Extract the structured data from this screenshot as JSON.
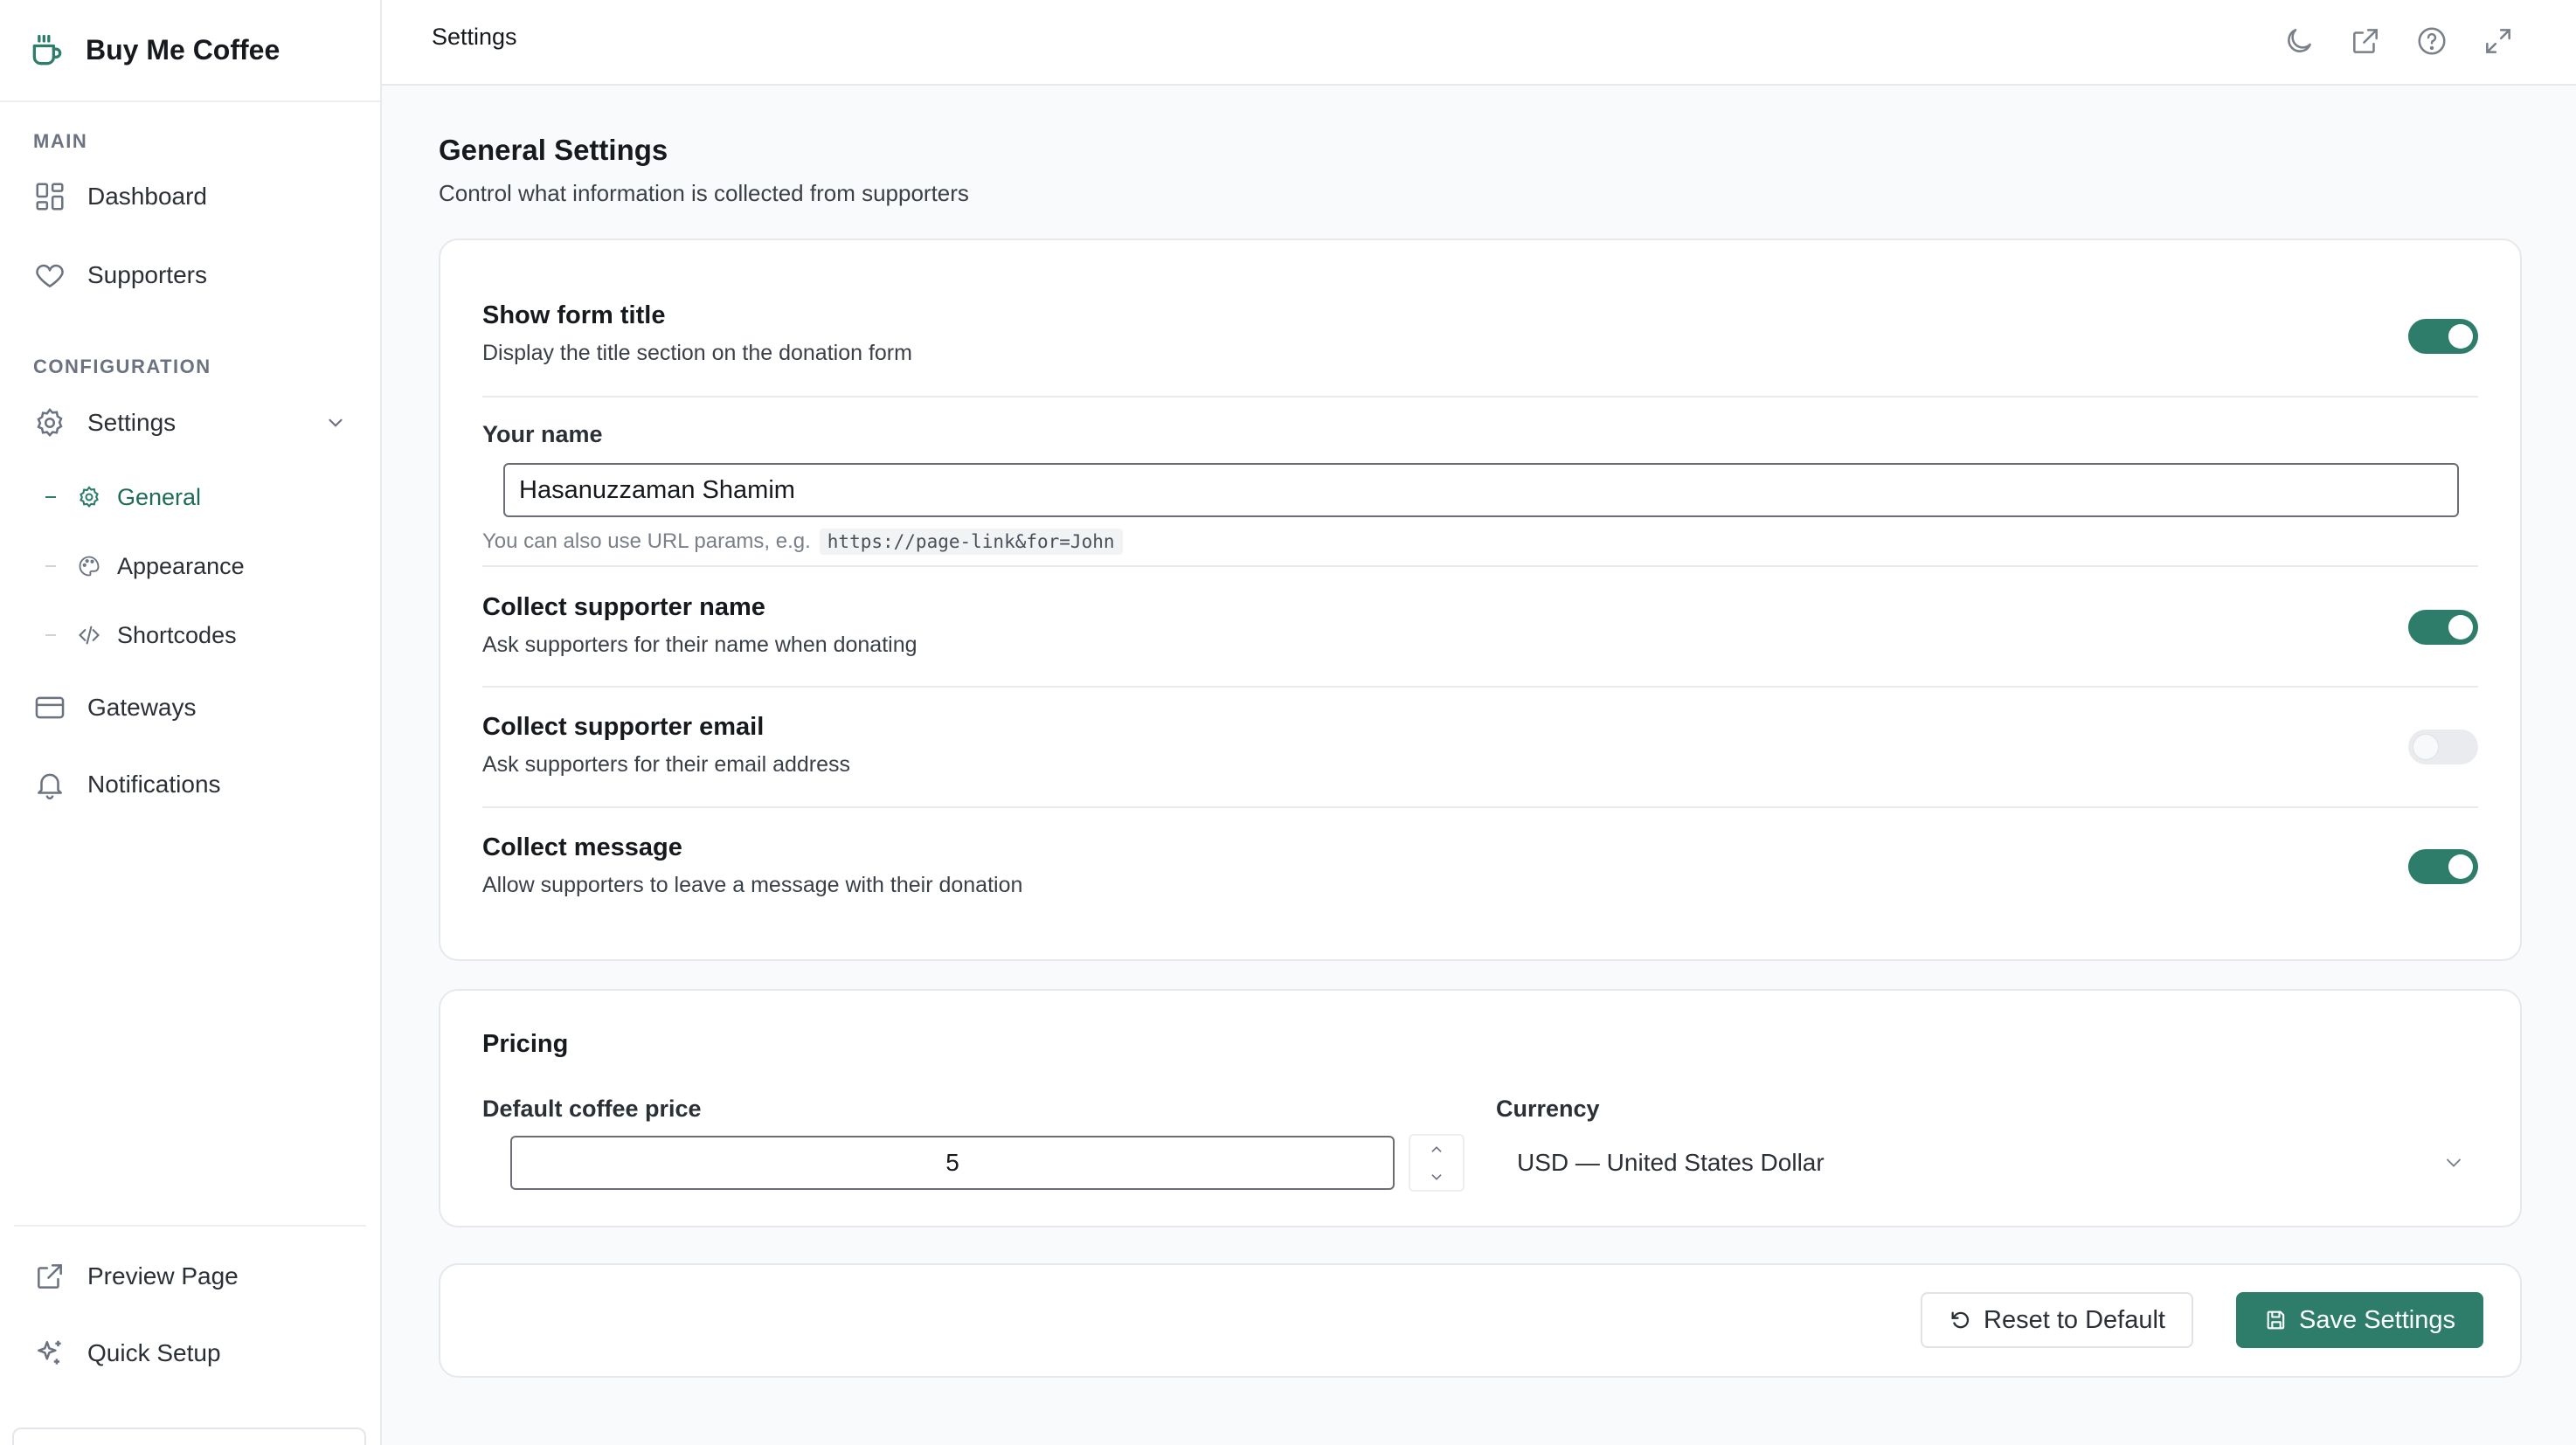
{
  "app": {
    "name": "Buy Me Coffee",
    "accent_color": "#2e7d6b"
  },
  "sidebar": {
    "main_label": "MAIN",
    "config_label": "CONFIGURATION",
    "items": [
      {
        "label": "Dashboard",
        "icon": "dashboard-icon"
      },
      {
        "label": "Supporters",
        "icon": "heart-icon"
      },
      {
        "label": "Settings",
        "icon": "gear-icon",
        "expanded": true
      },
      {
        "label": "Gateways",
        "icon": "credit-card-icon"
      },
      {
        "label": "Notifications",
        "icon": "bell-icon"
      }
    ],
    "settings_sub": [
      {
        "label": "General",
        "icon": "gear-icon",
        "active": true
      },
      {
        "label": "Appearance",
        "icon": "palette-icon"
      },
      {
        "label": "Shortcodes",
        "icon": "code-icon"
      }
    ],
    "bottom": [
      {
        "label": "Preview Page",
        "icon": "external-link-icon"
      },
      {
        "label": "Quick Setup",
        "icon": "sparkles-icon"
      }
    ]
  },
  "topbar": {
    "title": "Settings",
    "actions": [
      "moon-icon",
      "external-link-icon",
      "help-icon",
      "expand-icon"
    ]
  },
  "page": {
    "heading": "General Settings",
    "subheading": "Control what information is collected from supporters"
  },
  "general": {
    "show_form_title": {
      "title": "Show form title",
      "desc": "Display the title section on the donation form",
      "on": true
    },
    "your_name": {
      "label": "Your name",
      "value": "Hasanuzzaman Shamim",
      "help": "You can also use URL params, e.g.",
      "help_code": "https://page-link&for=John"
    },
    "collect_name": {
      "title": "Collect supporter name",
      "desc": "Ask supporters for their name when donating",
      "on": true
    },
    "collect_email": {
      "title": "Collect supporter email",
      "desc": "Ask supporters for their email address",
      "on": false
    },
    "collect_message": {
      "title": "Collect message",
      "desc": "Allow supporters to leave a message with their donation",
      "on": true
    }
  },
  "pricing": {
    "title": "Pricing",
    "price_label": "Default coffee price",
    "price_value": "5",
    "currency_label": "Currency",
    "currency_value": "USD — United States Dollar"
  },
  "actions": {
    "reset_label": "Reset to Default",
    "save_label": "Save Settings"
  }
}
